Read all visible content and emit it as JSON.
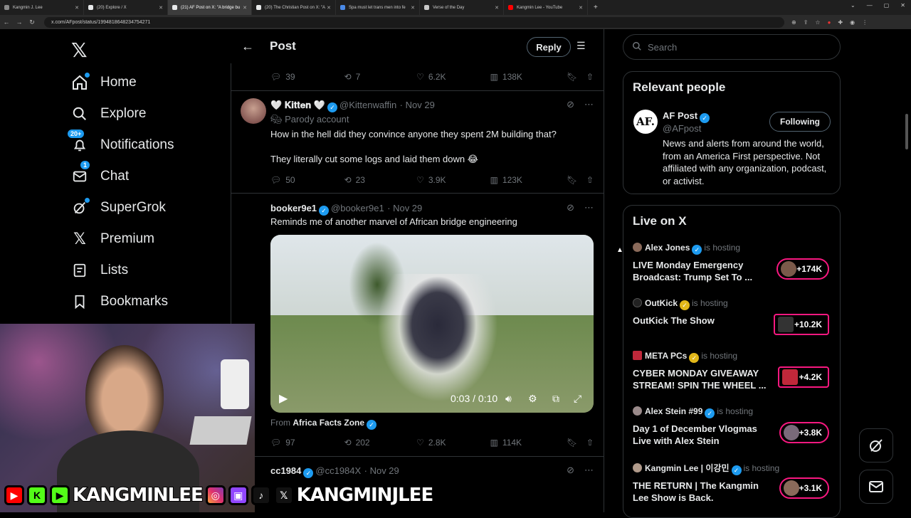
{
  "browser": {
    "tabs": [
      {
        "label": "Kangmin J. Lee",
        "color": "#8a8a8a",
        "active": false
      },
      {
        "label": "(20) Explore / X",
        "color": "#e7e9ea",
        "active": false
      },
      {
        "label": "(21) AF Post on X: \"A bridge bu",
        "color": "#e7e9ea",
        "active": true
      },
      {
        "label": "(20) The Christian Post on X: \"A",
        "color": "#e7e9ea",
        "active": false
      },
      {
        "label": "Spa must let trans men into fe",
        "color": "#4a8ae8",
        "active": false
      },
      {
        "label": "Verse of the Day",
        "color": "#c8c8c8",
        "active": false
      },
      {
        "label": "Kangmin Lee - YouTube",
        "color": "#ff0000",
        "active": false
      }
    ],
    "url": "x.com/AFpost/status/1994818648234754271"
  },
  "nav": {
    "items": [
      {
        "label": "Home",
        "icon": "home-icon"
      },
      {
        "label": "Explore",
        "icon": "search-icon"
      },
      {
        "label": "Notifications",
        "icon": "bell-icon",
        "badge": "20+"
      },
      {
        "label": "Chat",
        "icon": "mail-icon",
        "badge": "1"
      },
      {
        "label": "SuperGrok",
        "icon": "grok-icon"
      },
      {
        "label": "Premium",
        "icon": "x-icon"
      },
      {
        "label": "Lists",
        "icon": "list-icon"
      },
      {
        "label": "Bookmarks",
        "icon": "bookmark-icon"
      }
    ]
  },
  "header": {
    "title": "Post",
    "reply_label": "Reply"
  },
  "top_actions": {
    "replies": "39",
    "reposts": "7",
    "likes": "6.2K",
    "views": "138K"
  },
  "tweets": [
    {
      "name": "🤍 𝐊𝐢𝐭𝐭𝐞𝐧 🤍",
      "handle": "@Kittenwaffin",
      "date": "· Nov 29",
      "label": "Parody account",
      "text1": "How in the hell did they convince anyone they spent 2M building that?",
      "text2": "They literally cut some logs and laid them down 😂",
      "replies": "50",
      "reposts": "23",
      "likes": "3.9K",
      "views": "123K"
    },
    {
      "name": "booker9e1",
      "handle": "@booker9e1",
      "date": "· Nov 29",
      "text1": "Reminds me of another marvel of African bridge engineering",
      "video_time": "0:03 / 0:10",
      "from_prefix": "From",
      "from_name": "Africa Facts Zone",
      "replies": "97",
      "reposts": "202",
      "likes": "2.8K",
      "views": "114K"
    },
    {
      "name": "cc1984",
      "handle": "@cc1984X",
      "date": "· Nov 29"
    }
  ],
  "sidebar": {
    "search_placeholder": "Search",
    "relevant_title": "Relevant people",
    "person": {
      "name": "AF Post",
      "handle": "@AFpost",
      "avatar_text": "AF.",
      "follow_label": "Following",
      "bio": "News and alerts from around the world, from an America First perspective. Not affiliated with any organization, podcast, or activist."
    },
    "live_title": "Live on X",
    "live": [
      {
        "host": "Alex Jones",
        "is": "is hosting",
        "title": "LIVE Monday Emergency Broadcast: Trump Set To ...",
        "count": "+174K",
        "verified": "blue"
      },
      {
        "host": "OutKick",
        "is": "is hosting",
        "title": "OutKick The Show",
        "count": "+10.2K",
        "verified": "gold"
      },
      {
        "host": "META PCs",
        "is": "is hosting",
        "title": "CYBER MONDAY GIVEAWAY STREAM! SPIN THE WHEEL ...",
        "count": "+4.2K",
        "verified": "gold"
      },
      {
        "host": "Alex Stein #99",
        "is": "is hosting",
        "title": "Day 1 of December Vlogmas Live with Alex Stein",
        "count": "+3.8K",
        "verified": "blue"
      },
      {
        "host": "Kangmin Lee | 이강민",
        "is": "is hosting",
        "title": "THE RETURN | The Kangmin Lee Show is Back.",
        "count": "+3.1K",
        "verified": "blue"
      }
    ]
  },
  "overlay": {
    "channel_a": "KANGMINLEE",
    "channel_b": "KANGMINJLEE"
  },
  "colors": {
    "accent": "#1d9bf0",
    "live": "#f91880",
    "gold": "#e2b719"
  }
}
